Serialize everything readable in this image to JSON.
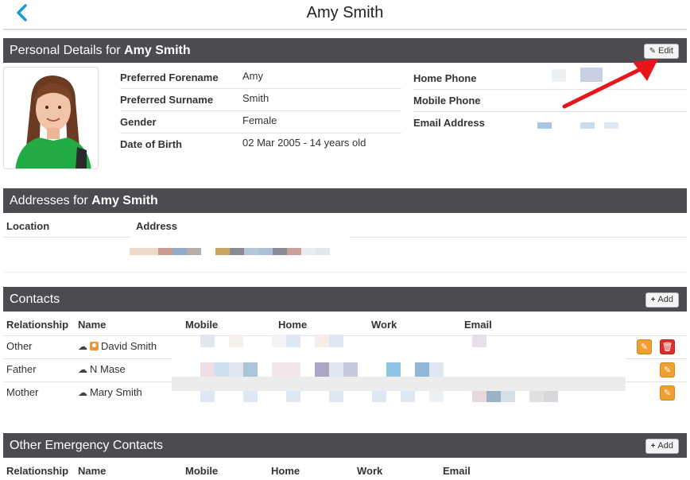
{
  "page": {
    "title": "Amy Smith"
  },
  "personal": {
    "header_prefix": "Personal Details for",
    "header_name": "Amy Smith",
    "edit_label": "Edit",
    "fields": [
      {
        "label": "Preferred Forename",
        "value": "Amy"
      },
      {
        "label": "Preferred Surname",
        "value": "Smith"
      },
      {
        "label": "Gender",
        "value": "Female"
      },
      {
        "label": "Date of Birth",
        "value": "02 Mar 2005 - 14 years old"
      }
    ],
    "contact_fields": [
      {
        "label": "Home Phone"
      },
      {
        "label": "Mobile Phone"
      },
      {
        "label": "Email Address"
      }
    ]
  },
  "addresses": {
    "header_prefix": "Addresses for",
    "header_name": "Amy Smith",
    "columns": [
      "Location",
      "Address"
    ]
  },
  "contacts": {
    "header": "Contacts",
    "add_label": "Add",
    "columns": [
      "Relationship",
      "Name",
      "Mobile",
      "Home",
      "Work",
      "Email"
    ],
    "rows": [
      {
        "relationship": "Other",
        "name": "David Smith"
      },
      {
        "relationship": "Father",
        "name": "N Mase"
      },
      {
        "relationship": "Mother",
        "name": "Mary Smith"
      }
    ]
  },
  "emergency": {
    "header": "Other Emergency Contacts",
    "add_label": "Add",
    "columns": [
      "Relationship",
      "Name",
      "Mobile",
      "Home",
      "Work",
      "Email"
    ]
  },
  "colors": {
    "header_bg": "#4a4c50",
    "accent_blue": "#1a9ad6",
    "edit_orange": "#f0a030",
    "delete_red": "#d9302c"
  }
}
